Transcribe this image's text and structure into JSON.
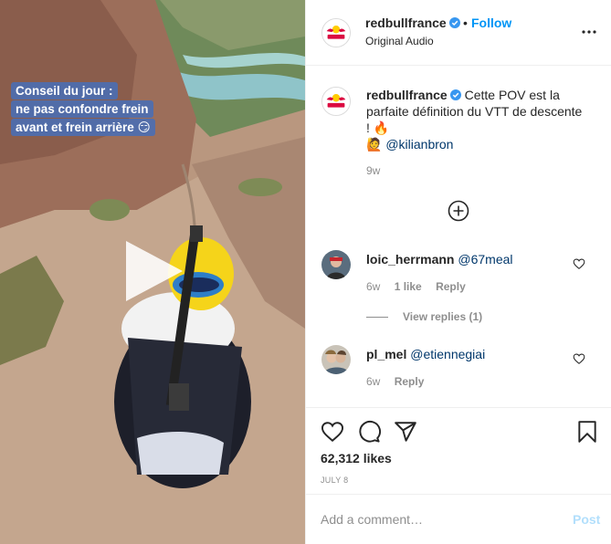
{
  "media": {
    "caption_lines": [
      "Conseil du jour :",
      "ne pas confondre frein",
      "avant et frein arrière 😏"
    ],
    "play_icon": "play-icon"
  },
  "header": {
    "username": "redbullfrance",
    "separator": "•",
    "follow_label": "Follow",
    "subtitle": "Original Audio",
    "more_icon": "more-options-icon"
  },
  "caption": {
    "username": "redbullfrance",
    "text": "Cette POV est la parfaite définition du VTT de descente ! 🔥",
    "tag_emoji": "🙋",
    "mention": "@kilianbron",
    "time": "9w"
  },
  "comments": [
    {
      "username": "loic_herrmann",
      "mention": "@67meal",
      "time": "6w",
      "likes": "1 like",
      "reply_label": "Reply",
      "view_replies": "View replies (1)"
    },
    {
      "username": "pl_mel",
      "mention": "@etiennegiai",
      "time": "6w",
      "reply_label": "Reply"
    }
  ],
  "actions": {
    "likes": "62,312 likes",
    "date": "JULY 8"
  },
  "composer": {
    "placeholder": "Add a comment…",
    "post_label": "Post"
  },
  "colors": {
    "accent": "#0095f6",
    "post_disabled": "#b2dffc",
    "muted": "#8e8e8e",
    "redbull_red": "#db0a40",
    "redbull_yellow": "#ffcc00"
  }
}
